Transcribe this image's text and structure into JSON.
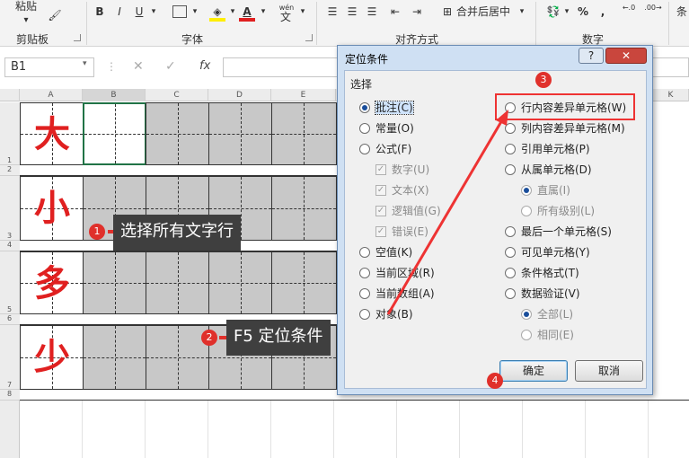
{
  "ribbon": {
    "paste_label": "粘贴",
    "clipboard_group": "剪贴板",
    "font_group": "字体",
    "align_group": "对齐方式",
    "number_group": "数字",
    "bold": "B",
    "italic": "I",
    "underline": "U",
    "font_color_letter": "A",
    "wen_label": "wén",
    "wen_char": "文",
    "merge_label": "合并后居中",
    "percent": "%",
    "comma": ",",
    "cond_cut": "条",
    "dec_up": "←.0",
    "dec_down": ".00→"
  },
  "formula_bar": {
    "name_box": "B1",
    "fx": "fx",
    "cancel": "✕",
    "confirm": "✓"
  },
  "grid": {
    "columns": [
      "A",
      "B",
      "C",
      "D",
      "E",
      "K"
    ],
    "rows": [
      "1",
      "2",
      "3",
      "4",
      "5",
      "6",
      "7",
      "8"
    ],
    "big_chars": [
      "大",
      "小",
      "多",
      "少"
    ]
  },
  "callouts": {
    "c1_num": "1",
    "c1_text": "选择所有文字行",
    "c2_num": "2",
    "c2_text": "F5 定位条件",
    "c3_num": "3",
    "c4_num": "4"
  },
  "dialog": {
    "title": "定位条件",
    "help": "?",
    "close": "✕",
    "section": "选择",
    "left_options": [
      {
        "label": "批注(C)",
        "type": "radio",
        "selected": true,
        "disabled": false
      },
      {
        "label": "常量(O)",
        "type": "radio",
        "selected": false,
        "disabled": false
      },
      {
        "label": "公式(F)",
        "type": "radio",
        "selected": false,
        "disabled": false
      },
      {
        "label": "数字(U)",
        "type": "check",
        "selected": true,
        "disabled": true
      },
      {
        "label": "文本(X)",
        "type": "check",
        "selected": true,
        "disabled": true
      },
      {
        "label": "逻辑值(G)",
        "type": "check",
        "selected": true,
        "disabled": true
      },
      {
        "label": "错误(E)",
        "type": "check",
        "selected": true,
        "disabled": true
      },
      {
        "label": "空值(K)",
        "type": "radio",
        "selected": false,
        "disabled": false
      },
      {
        "label": "当前区域(R)",
        "type": "radio",
        "selected": false,
        "disabled": false
      },
      {
        "label": "当前数组(A)",
        "type": "radio",
        "selected": false,
        "disabled": false
      },
      {
        "label": "对象(B)",
        "type": "radio",
        "selected": false,
        "disabled": false
      }
    ],
    "right_options": [
      {
        "label": "行内容差异单元格(W)",
        "type": "radio",
        "selected": false,
        "disabled": false
      },
      {
        "label": "列内容差异单元格(M)",
        "type": "radio",
        "selected": false,
        "disabled": false
      },
      {
        "label": "引用单元格(P)",
        "type": "radio",
        "selected": false,
        "disabled": false
      },
      {
        "label": "从属单元格(D)",
        "type": "radio",
        "selected": false,
        "disabled": false
      },
      {
        "label": "直属(I)",
        "type": "radio",
        "selected": true,
        "disabled": true
      },
      {
        "label": "所有级别(L)",
        "type": "radio",
        "selected": false,
        "disabled": true
      },
      {
        "label": "最后一个单元格(S)",
        "type": "radio",
        "selected": false,
        "disabled": false
      },
      {
        "label": "可见单元格(Y)",
        "type": "radio",
        "selected": false,
        "disabled": false
      },
      {
        "label": "条件格式(T)",
        "type": "radio",
        "selected": false,
        "disabled": false
      },
      {
        "label": "数据验证(V)",
        "type": "radio",
        "selected": false,
        "disabled": false
      },
      {
        "label": "全部(L)",
        "type": "radio",
        "selected": true,
        "disabled": true
      },
      {
        "label": "相同(E)",
        "type": "radio",
        "selected": false,
        "disabled": true
      }
    ],
    "ok": "确定",
    "cancel": "取消"
  },
  "colors": {
    "accent_red": "#e33333",
    "selection_grey": "#c8c8c8",
    "char_red": "#e02020"
  }
}
